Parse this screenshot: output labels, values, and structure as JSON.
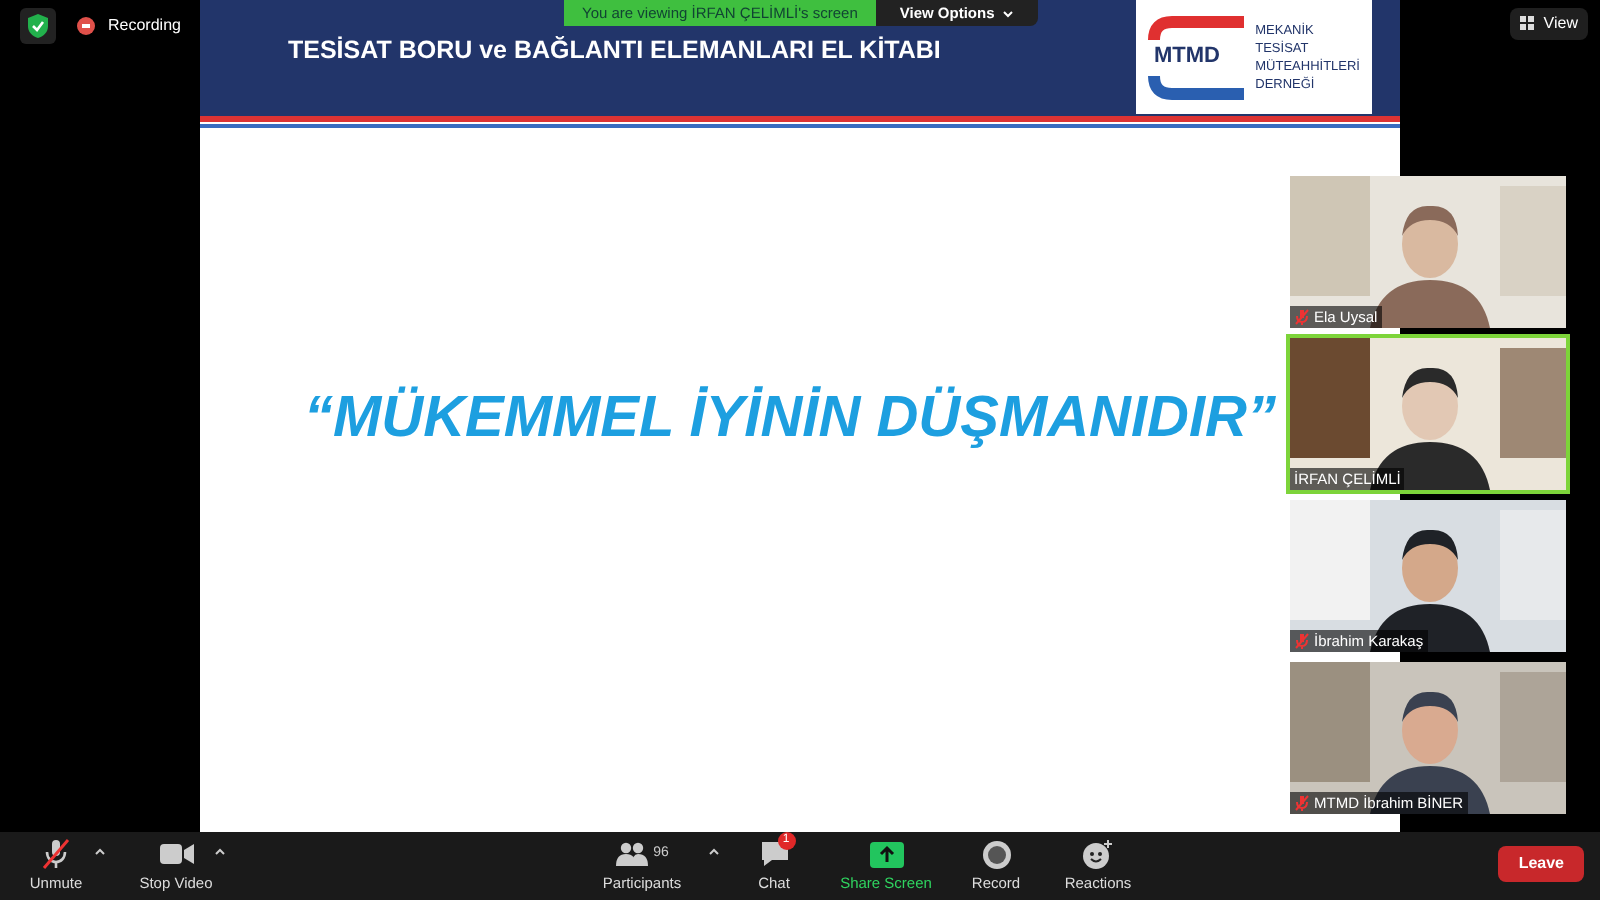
{
  "top_bar": {
    "recording": "Recording",
    "view_button": "View"
  },
  "share_banner": {
    "text": "You are viewing İRFAN ÇELİMLİ's screen",
    "options": "View Options"
  },
  "slide": {
    "title": "TESİSAT BORU ve BAĞLANTI ELEMANLARI EL KİTABI",
    "logo_mark": "MTMD",
    "logo_lines": [
      "MEKANİK",
      "TESİSAT",
      "MÜTEAHHİTLERİ",
      "DERNEĞİ"
    ],
    "quote": "“MÜKEMMEL İYİNİN DÜŞMANIDIR”"
  },
  "participants": [
    {
      "name": "Ela Uysal",
      "muted": true,
      "selected": false
    },
    {
      "name": "İRFAN ÇELİMLİ",
      "muted": false,
      "selected": true
    },
    {
      "name": "İbrahim Karakaş",
      "muted": true,
      "selected": false
    },
    {
      "name": "MTMD İbrahim BİNER",
      "muted": true,
      "selected": false
    }
  ],
  "toolbar": [
    {
      "kind": "mic",
      "label": "Unmute",
      "muted": true,
      "caret": true
    },
    {
      "kind": "video",
      "label": "Stop Video",
      "caret": true
    },
    {
      "kind": "participants",
      "label": "Participants",
      "count": "96",
      "caret": true
    },
    {
      "kind": "chat",
      "label": "Chat",
      "badge": "1"
    },
    {
      "kind": "share",
      "label": "Share Screen"
    },
    {
      "kind": "record",
      "label": "Record"
    },
    {
      "kind": "reactions",
      "label": "Reactions"
    }
  ],
  "leave": "Leave"
}
